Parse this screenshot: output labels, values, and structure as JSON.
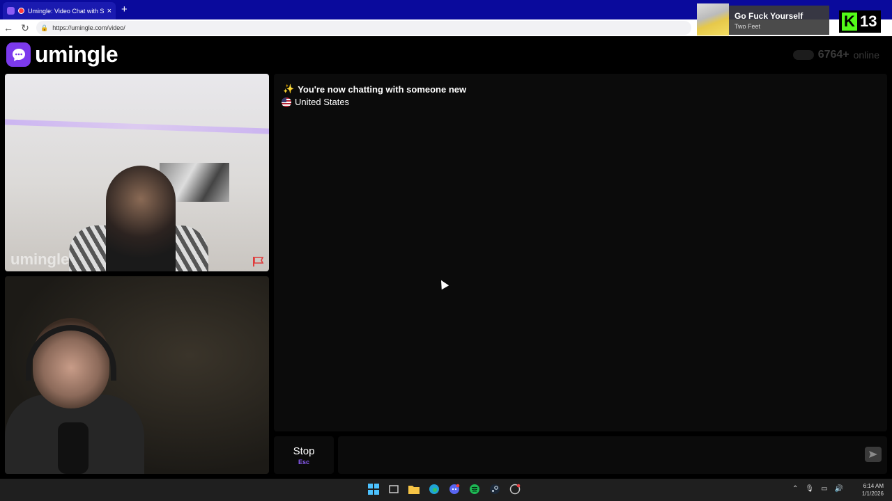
{
  "browser": {
    "tab_title": "Umingle: Video Chat with Str",
    "url": "https://umingle.com/video/"
  },
  "music_overlay": {
    "song": "Go Fuck Yourself",
    "artist": "Two Feet"
  },
  "kick_overlay": {
    "count": "13"
  },
  "app": {
    "logo_text": "umingle",
    "online_count": "6764+",
    "online_label": "online",
    "watermark": "umingle"
  },
  "chat": {
    "status_emoji": "✨",
    "status_text": "You're now chatting with someone new",
    "country": "United States"
  },
  "controls": {
    "stop_label": "Stop",
    "stop_key": "Esc"
  },
  "taskbar": {
    "time": "6:14 AM",
    "date": "1/1/2026"
  },
  "colors": {
    "accent": "#7c3aed",
    "browser_bar": "#0a0a9c"
  }
}
